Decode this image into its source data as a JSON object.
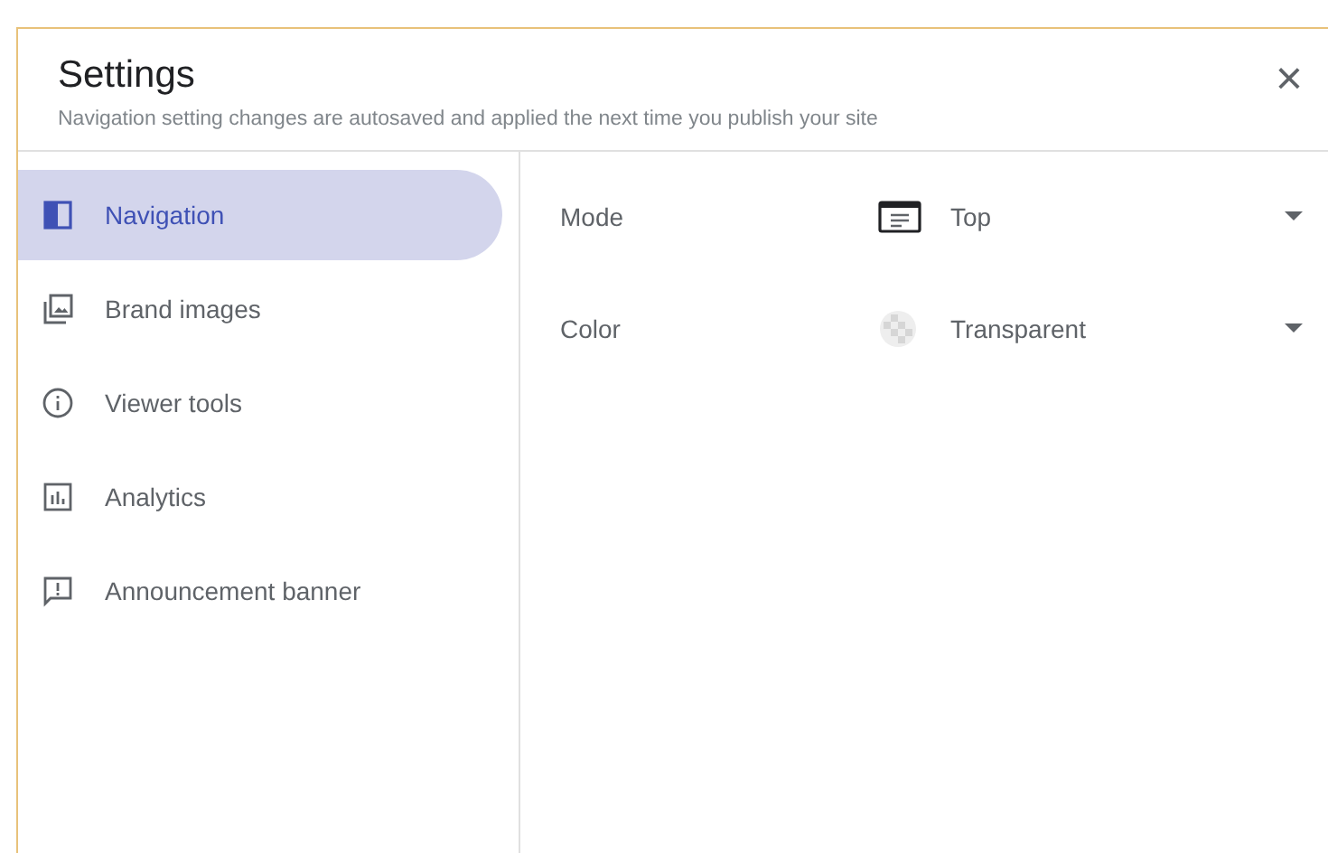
{
  "dialog": {
    "title": "Settings",
    "subtitle": "Navigation setting changes are autosaved and applied the next time you publish your site",
    "close": "×"
  },
  "sidebar": {
    "items": [
      {
        "label": "Navigation",
        "selected": true
      },
      {
        "label": "Brand images",
        "selected": false
      },
      {
        "label": "Viewer tools",
        "selected": false
      },
      {
        "label": "Analytics",
        "selected": false
      },
      {
        "label": "Announcement banner",
        "selected": false
      }
    ]
  },
  "settings": [
    {
      "label": "Mode",
      "value": "Top"
    },
    {
      "label": "Color",
      "value": "Transparent"
    }
  ]
}
